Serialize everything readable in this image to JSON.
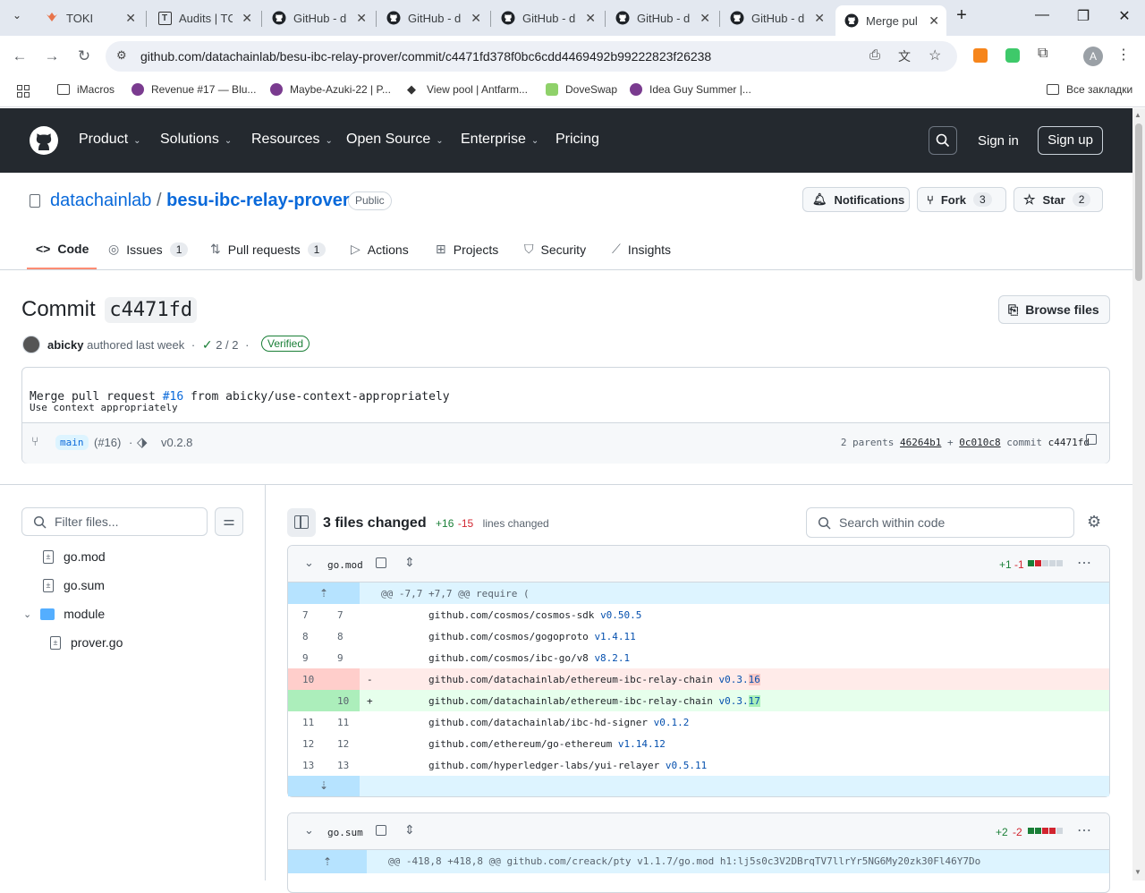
{
  "browser": {
    "tabs": [
      {
        "title": "TOKI",
        "icon": "toki-icon"
      },
      {
        "title": "Audits | TC",
        "icon": "t-icon"
      },
      {
        "title": "GitHub - d",
        "icon": "github-icon"
      },
      {
        "title": "GitHub - d",
        "icon": "github-icon"
      },
      {
        "title": "GitHub - d",
        "icon": "github-icon"
      },
      {
        "title": "GitHub - d",
        "icon": "github-icon"
      },
      {
        "title": "GitHub - d",
        "icon": "github-icon"
      },
      {
        "title": "Merge pul",
        "icon": "github-icon"
      }
    ],
    "url": "github.com/datachainlab/besu-ibc-relay-prover/commit/c4471fd378f0bc6cdd4469492b99222823f26238",
    "avatar_letter": "A",
    "bookmarks": [
      "iMacros",
      "Revenue #17 — Blu...",
      "Maybe-Azuki-22 | P...",
      "View pool | Antfarm...",
      "DoveSwap",
      "Idea Guy Summer |..."
    ],
    "all_bookmarks": "Все закладки"
  },
  "gh": {
    "nav": [
      "Product",
      "Solutions",
      "Resources",
      "Open Source",
      "Enterprise",
      "Pricing"
    ],
    "sign_in": "Sign in",
    "sign_up": "Sign up"
  },
  "repo": {
    "owner": "datachainlab",
    "sep": "/",
    "name": "besu-ibc-relay-prover",
    "visibility": "Public",
    "notifications": "Notifications",
    "fork": "Fork",
    "fork_count": "3",
    "star": "Star",
    "star_count": "2",
    "tabs": [
      {
        "label": "Code"
      },
      {
        "label": "Issues",
        "count": "1"
      },
      {
        "label": "Pull requests",
        "count": "1"
      },
      {
        "label": "Actions"
      },
      {
        "label": "Projects"
      },
      {
        "label": "Security"
      },
      {
        "label": "Insights"
      }
    ]
  },
  "commit": {
    "heading": "Commit",
    "sha": "c4471fd",
    "browse": "Browse files",
    "author": "abicky",
    "authored": "authored last week",
    "dot": "·",
    "checks": "2 / 2",
    "verified": "Verified",
    "msg_prefix": "Merge pull request ",
    "msg_link": "#16",
    "msg_suffix": " from abicky/use-context-appropriately",
    "body": "Use context appropriately",
    "branch": "main",
    "pr": "(#16)",
    "tag": "v0.2.8",
    "parents_label": "2 parents",
    "parent1": "46264b1",
    "plus": "+",
    "parent2": "0c010c8",
    "commit_label": "commit",
    "commit_sha": "c4471fd"
  },
  "files": {
    "filter_placeholder": "Filter files...",
    "tree": [
      "go.mod",
      "go.sum",
      "module",
      "prover.go"
    ],
    "changed": "3 files changed",
    "additions": "+16",
    "deletions": "-15",
    "lines_changed": "lines changed",
    "search_placeholder": "Search within code"
  },
  "diff1": {
    "filename": "go.mod",
    "add": "+1",
    "del": "-1",
    "hunk": "@@ -7,7 +7,7 @@ require (",
    "lines": [
      {
        "o": "7",
        "n": "7",
        "s": "",
        "pre": "github.com/cosmos/cosmos-sdk ",
        "ver": "v0.50.5",
        "hl": ""
      },
      {
        "o": "8",
        "n": "8",
        "s": "",
        "pre": "github.com/cosmos/gogoproto ",
        "ver": "v1.4.11",
        "hl": ""
      },
      {
        "o": "9",
        "n": "9",
        "s": "",
        "pre": "github.com/cosmos/ibc-go/v8 ",
        "ver": "v8.2.1",
        "hl": ""
      },
      {
        "o": "10",
        "n": "",
        "s": "-",
        "pre": "github.com/datachainlab/ethereum-ibc-relay-chain ",
        "ver": "v0.3.",
        "hl": "16",
        "type": "del"
      },
      {
        "o": "",
        "n": "10",
        "s": "+",
        "pre": "github.com/datachainlab/ethereum-ibc-relay-chain ",
        "ver": "v0.3.",
        "hl": "17",
        "type": "add"
      },
      {
        "o": "11",
        "n": "11",
        "s": "",
        "pre": "github.com/datachainlab/ibc-hd-signer ",
        "ver": "v0.1.2",
        "hl": ""
      },
      {
        "o": "12",
        "n": "12",
        "s": "",
        "pre": "github.com/ethereum/go-ethereum ",
        "ver": "v1.14.12",
        "hl": ""
      },
      {
        "o": "13",
        "n": "13",
        "s": "",
        "pre": "github.com/hyperledger-labs/yui-relayer ",
        "ver": "v0.5.11",
        "hl": ""
      }
    ]
  },
  "diff2": {
    "filename": "go.sum",
    "add": "+2",
    "del": "-2",
    "hunk": "@@ -418,8 +418,8 @@ github.com/creack/pty v1.1.7/go.mod h1:lj5s0c3V2DBrqTV7llrYr5NG6My20zk30Fl46Y7Do"
  }
}
